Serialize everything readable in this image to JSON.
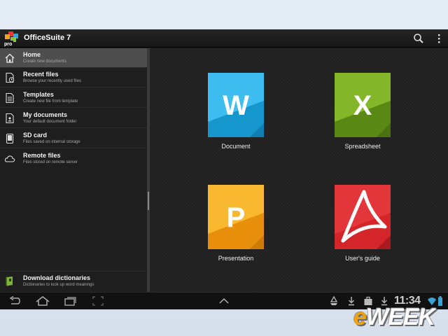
{
  "app": {
    "title": "OfficeSuite 7",
    "logo_text": "pro"
  },
  "actionbar": {
    "icons": [
      "search-icon",
      "overflow-menu-icon"
    ]
  },
  "sidebar": {
    "items": [
      {
        "title": "Home",
        "subtitle": "Create new documents",
        "icon": "home-icon",
        "active": true
      },
      {
        "title": "Recent files",
        "subtitle": "Browse your recently used files",
        "icon": "recent-files-icon",
        "active": false
      },
      {
        "title": "Templates",
        "subtitle": "Create new file from template",
        "icon": "templates-icon",
        "active": false
      },
      {
        "title": "My documents",
        "subtitle": "Your default document folder",
        "icon": "my-documents-icon",
        "active": false
      },
      {
        "title": "SD card",
        "subtitle": "Files saved on internal storage",
        "icon": "sd-card-icon",
        "active": false
      },
      {
        "title": "Remote files",
        "subtitle": "Files stored on remote server",
        "icon": "cloud-icon",
        "active": false
      }
    ],
    "footer": {
      "title": "Download dictionaries",
      "subtitle": "Dictionaries to look up word meanings",
      "icon": "dictionary-icon"
    }
  },
  "main": {
    "tiles": [
      {
        "label": "Document",
        "letter": "W",
        "icon": "word-document-icon",
        "color": "#1ea6dc"
      },
      {
        "label": "Spreadsheet",
        "letter": "X",
        "icon": "spreadsheet-icon",
        "color": "#6a9a1a"
      },
      {
        "label": "Presentation",
        "letter": "P",
        "icon": "presentation-icon",
        "color": "#f0a014"
      },
      {
        "label": "User's guide",
        "letter": "",
        "icon": "pdf-guide-icon",
        "color": "#d4262a"
      }
    ]
  },
  "navbar": {
    "left_icons": [
      "back-icon",
      "home-nav-icon",
      "recent-apps-icon",
      "screenshot-icon"
    ],
    "center_icon": "chevron-up-icon",
    "status_icons": [
      "recycle-icon",
      "download-icon",
      "briefcase-icon",
      "download-icon",
      "wifi-icon",
      "battery-icon"
    ],
    "clock": "11:34"
  },
  "watermark": {
    "brand": "eWEEK",
    "accent": "#f1a20c"
  }
}
